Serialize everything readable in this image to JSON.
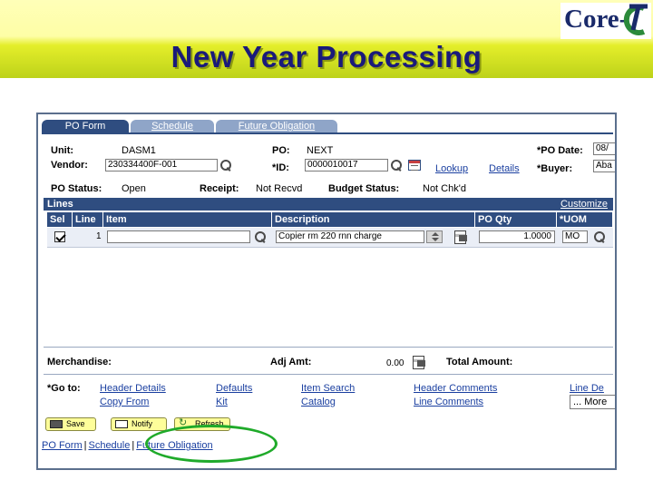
{
  "slide": {
    "title": "New Year Processing",
    "logo_text": "Core-",
    "logo_mark": "CT"
  },
  "tabs": [
    {
      "label": "PO Form",
      "active": true
    },
    {
      "label": "Schedule",
      "active": false
    },
    {
      "label": "Future Obligation",
      "active": false
    }
  ],
  "header": {
    "unit_label": "Unit:",
    "unit_value": "DASM1",
    "vendor_label": "Vendor:",
    "vendor_value": "230334400F-001",
    "po_label": "PO:",
    "po_value": "NEXT",
    "id_label": "*ID:",
    "id_value": "0000010017",
    "lookup_link": "Lookup",
    "details_link": "Details",
    "po_date_label": "*PO Date:",
    "po_date_value": "08/",
    "buyer_label": "*Buyer:",
    "buyer_value": "Aba",
    "po_status_label": "PO Status:",
    "po_status_value": "Open",
    "receipt_label": "Receipt:",
    "receipt_value": "Not Recvd",
    "budget_status_label": "Budget Status:",
    "budget_status_value": "Not Chk'd"
  },
  "lines": {
    "title": "Lines",
    "customize_link": "Customize",
    "columns": [
      "Sel",
      "Line",
      "Item",
      "Description",
      "PO Qty",
      "*UOM"
    ],
    "rows": [
      {
        "line": "1",
        "item": "",
        "description": "Copier rm 220 rnn charge",
        "po_qty": "1.0000",
        "uom": "MO",
        "selected": true
      }
    ]
  },
  "totals": {
    "merchandise_label": "Merchandise:",
    "adj_amt_label": "Adj Amt:",
    "adj_amt_value": "0.00",
    "total_amount_label": "Total Amount:"
  },
  "goto": {
    "label": "*Go to:",
    "links_row1": [
      "Header Details",
      "Defaults",
      "Item Search",
      "Header Comments",
      "Line De"
    ],
    "links_row2": [
      "Copy From",
      "Kit",
      "Catalog",
      "Line Comments"
    ],
    "more_value": "... More"
  },
  "buttons": {
    "save": "Save",
    "notify": "Notify",
    "refresh": "Refresh"
  },
  "footer_links": [
    "PO Form",
    "Schedule",
    "Future Obligation"
  ],
  "colors": {
    "header_navy": "#2f4d80",
    "highlight_green": "#1faa2a",
    "banner_yellow": "#e4ee2a"
  }
}
